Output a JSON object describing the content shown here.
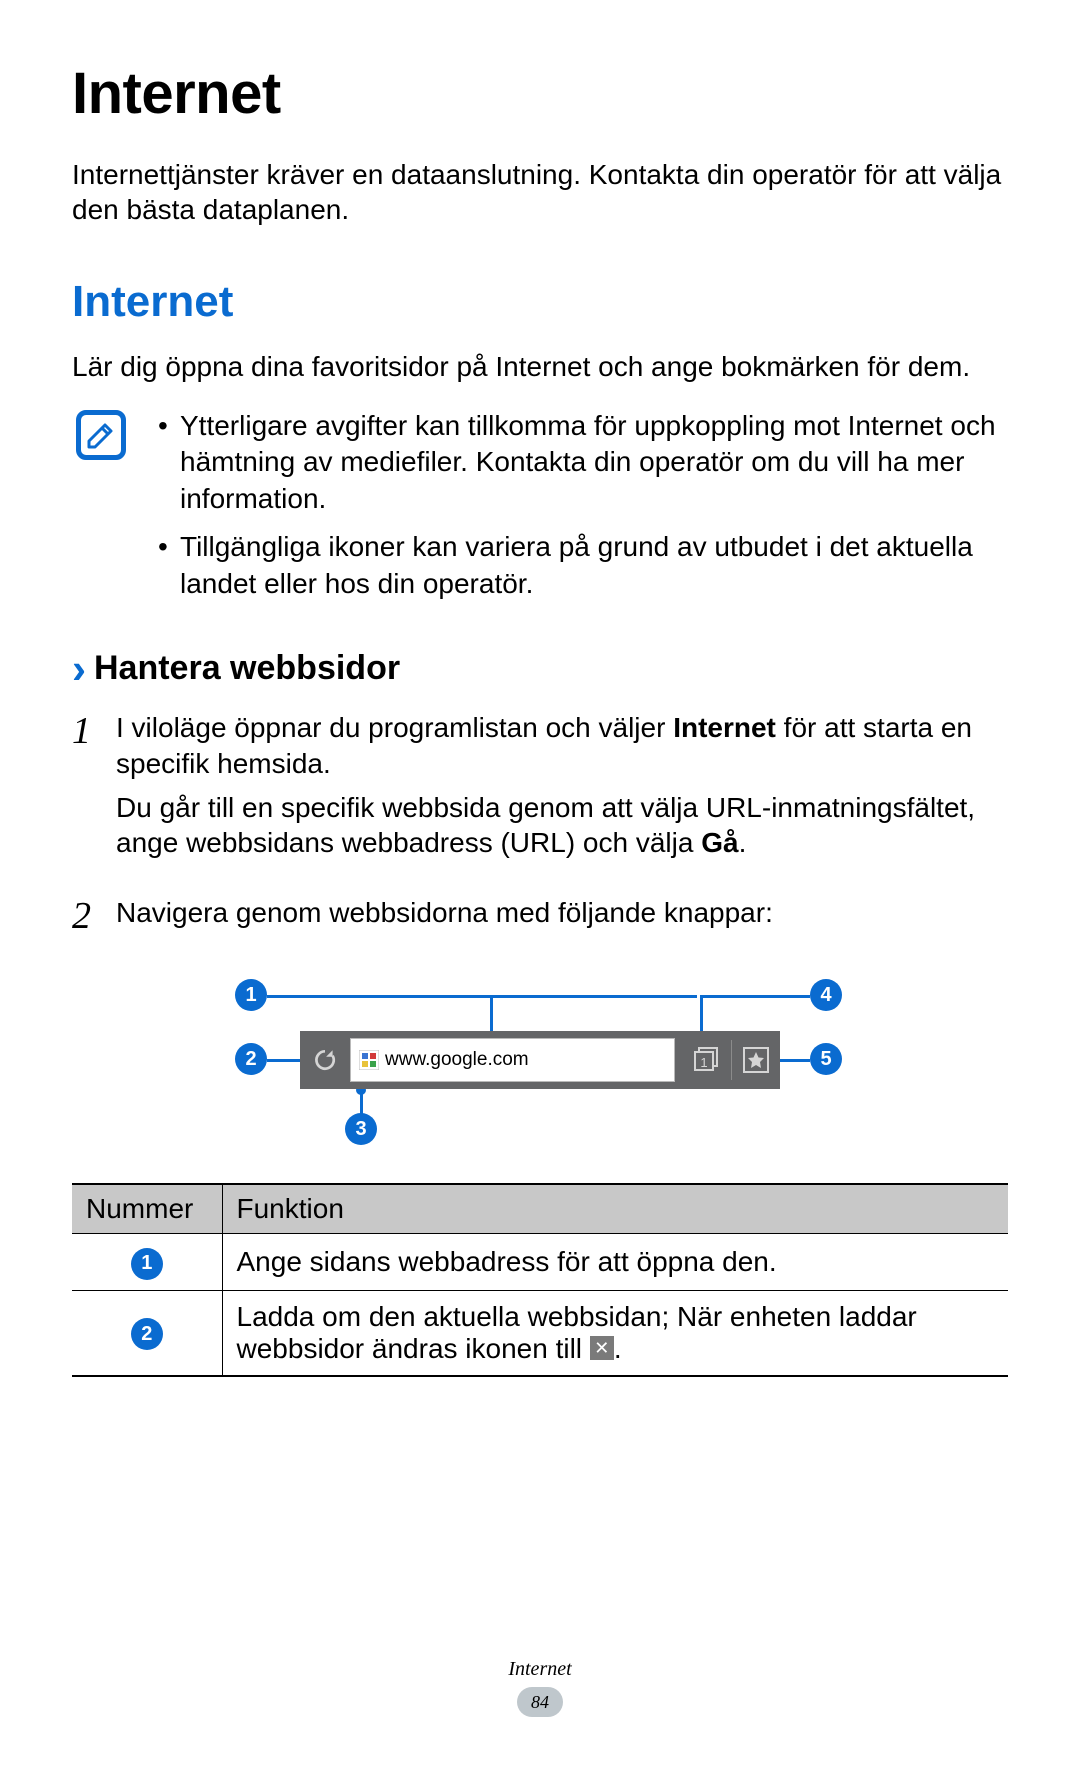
{
  "title": "Internet",
  "intro": "Internettjänster kräver en dataanslutning. Kontakta din operatör för att välja den bästa dataplanen.",
  "section_heading": "Internet",
  "section_intro": "Lär dig öppna dina favoritsidor på Internet och ange bokmärken för dem.",
  "note_items": [
    "Ytterligare avgifter kan tillkomma för uppkoppling mot Internet och hämtning av mediefiler. Kontakta din operatör om du vill ha mer information.",
    "Tillgängliga ikoner kan variera på grund av utbudet i det aktuella landet eller hos din operatör."
  ],
  "subheading": "Hantera webbsidor",
  "steps": {
    "one_a_pre": "I viloläge öppnar du programlistan och väljer ",
    "one_a_bold": "Internet",
    "one_a_post": " för att starta en specifik hemsida.",
    "one_b_pre": "Du går till en specifik webbsida genom att välja URL-inmatningsfältet, ange webbsidans webbadress (URL) och välja ",
    "one_b_bold": "Gå",
    "one_b_post": ".",
    "two": "Navigera genom webbsidorna med följande knappar:"
  },
  "diagram": {
    "url": "www.google.com",
    "window_count": "1",
    "callouts": {
      "c1": "1",
      "c2": "2",
      "c3": "3",
      "c4": "4",
      "c5": "5"
    }
  },
  "table": {
    "header_number": "Nummer",
    "header_function": "Funktion",
    "rows": [
      {
        "num": "1",
        "desc": "Ange sidans webbadress för att öppna den."
      },
      {
        "num": "2",
        "desc_pre": "Ladda om den aktuella webbsidan; När enheten laddar webbsidor ändras ikonen till ",
        "has_icon": true,
        "desc_post": "."
      }
    ]
  },
  "footer": {
    "section": "Internet",
    "page": "84"
  }
}
